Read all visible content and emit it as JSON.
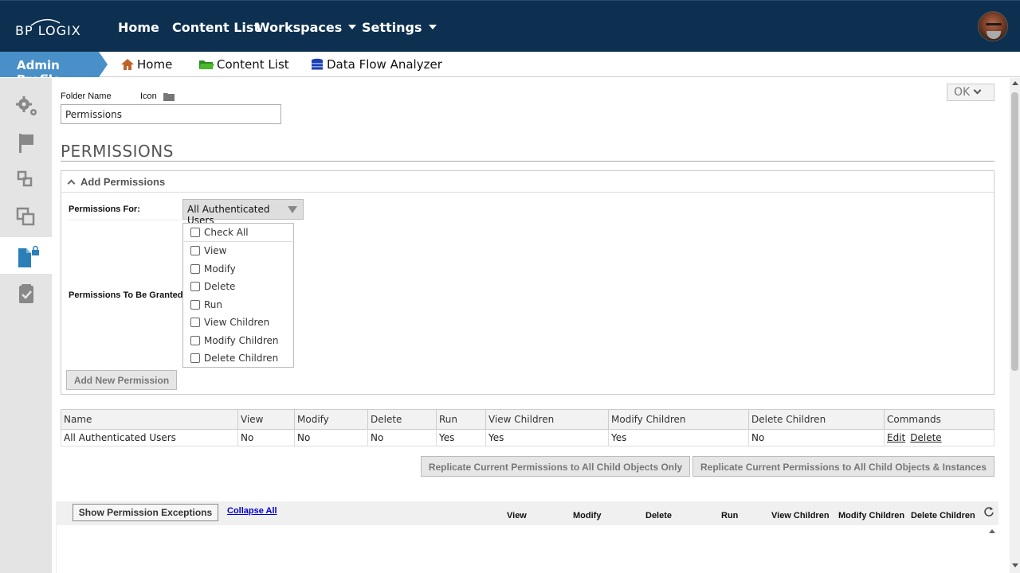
{
  "topbar": {
    "logo_text": "BP LOGIX",
    "nav": [
      "Home",
      "Content List",
      "Workspaces",
      "Settings"
    ]
  },
  "secondary": {
    "breadcrumb": "Admin Profile",
    "links": [
      "Home",
      "Content List",
      "Data Flow Analyzer"
    ]
  },
  "folder": {
    "name_label": "Folder Name",
    "icon_label": "Icon",
    "name_value": "Permissions"
  },
  "ok_button": "OK",
  "section_title": "PERMISSIONS",
  "add_panel": {
    "title": "Add Permissions",
    "for_label": "Permissions For:",
    "for_value": "All Authenticated Users",
    "granted_label": "Permissions To Be Granted",
    "check_all": "Check All",
    "options": [
      "View",
      "Modify",
      "Delete",
      "Run",
      "View Children",
      "Modify Children",
      "Delete Children"
    ],
    "add_button": "Add New Permission"
  },
  "table": {
    "headers": [
      "Name",
      "View",
      "Modify",
      "Delete",
      "Run",
      "View Children",
      "Modify Children",
      "Delete Children",
      "Commands"
    ],
    "rows": [
      [
        "All Authenticated Users",
        "No",
        "No",
        "No",
        "Yes",
        "Yes",
        "Yes",
        "No"
      ]
    ],
    "commands": [
      "Edit",
      "Delete"
    ]
  },
  "replicate": {
    "child_only": "Replicate Current Permissions to All Child Objects Only",
    "child_instances": "Replicate Current Permissions to All Child Objects & Instances"
  },
  "exceptions": {
    "show_button": "Show Permission Exceptions",
    "collapse_link": "Collapse All",
    "columns": [
      "View",
      "Modify",
      "Delete",
      "Run",
      "View Children",
      "Modify Children",
      "Delete Children"
    ]
  },
  "colors": {
    "topbar": "#0d3050",
    "breadcrumb": "#4a90c8",
    "sidebar": "#e4e4e4",
    "active_icon": "#2a7fb8"
  },
  "icons": {
    "sidebar": [
      "gears-icon",
      "flag-icon",
      "workflow-icon",
      "copy-icon",
      "locked-document-icon",
      "checklist-icon"
    ],
    "links": [
      "home-icon",
      "folder-icon",
      "database-icon"
    ]
  }
}
